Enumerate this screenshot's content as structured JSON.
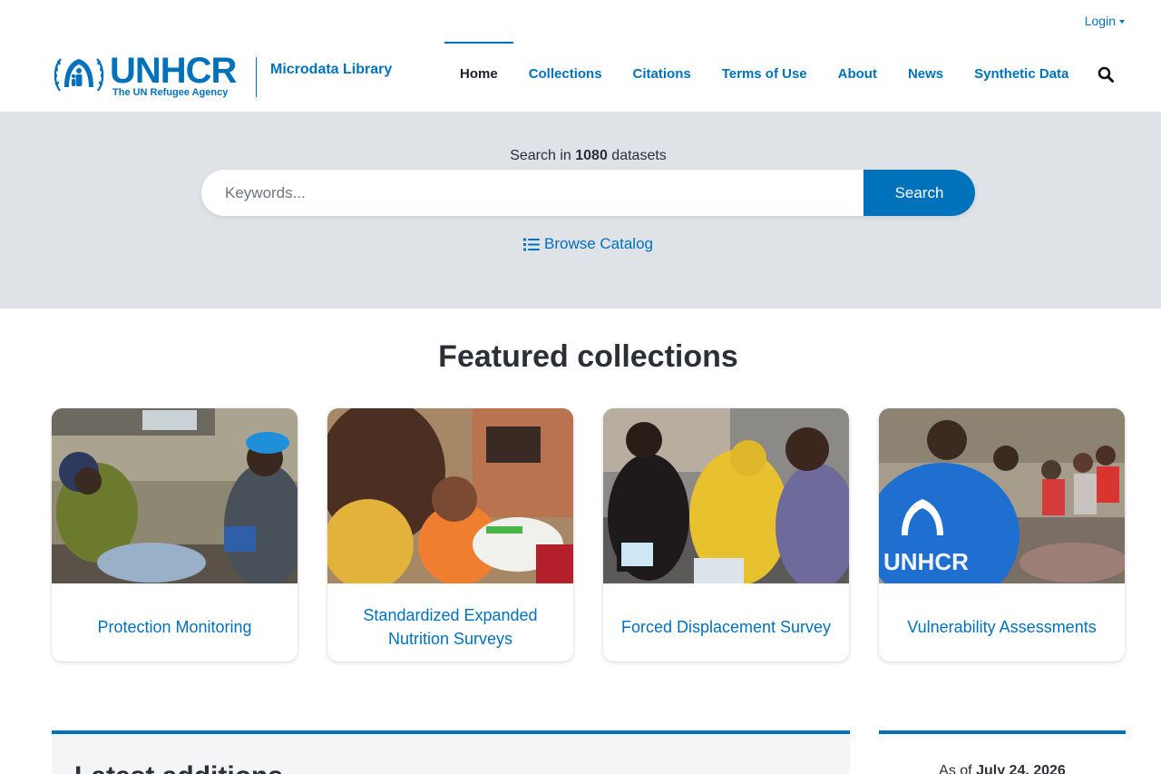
{
  "header": {
    "login_label": "Login",
    "logo": {
      "word": "UNHCR",
      "subtitle": "The UN Refugee Agency"
    },
    "site_name": "Microdata Library",
    "nav": [
      {
        "label": "Home",
        "active": true
      },
      {
        "label": "Collections",
        "active": false
      },
      {
        "label": "Citations",
        "active": false
      },
      {
        "label": "Terms of Use",
        "active": false
      },
      {
        "label": "About",
        "active": false
      },
      {
        "label": "News",
        "active": false
      },
      {
        "label": "Synthetic Data",
        "active": false
      }
    ],
    "search_icon": "search-icon"
  },
  "hero": {
    "caption_prefix": "Search in",
    "dataset_count": "1080",
    "caption_suffix": "datasets",
    "search_placeholder": "Keywords...",
    "search_button": "Search",
    "browse_icon": "list-icon",
    "browse_label": "Browse Catalog"
  },
  "featured": {
    "title": "Featured collections",
    "cards": [
      {
        "label": "Protection Monitoring"
      },
      {
        "label": "Standardized Expanded Nutrition Surveys"
      },
      {
        "label": "Forced Displacement Survey"
      },
      {
        "label": "Vulnerability Assessments"
      }
    ]
  },
  "latest": {
    "title": "Latest additions"
  },
  "asof": {
    "prefix": "As of",
    "date": "July 24, 2026"
  },
  "colors": {
    "brand": "#0072bc",
    "hero_bg": "#dfe2e7",
    "text": "#2b2f36"
  }
}
